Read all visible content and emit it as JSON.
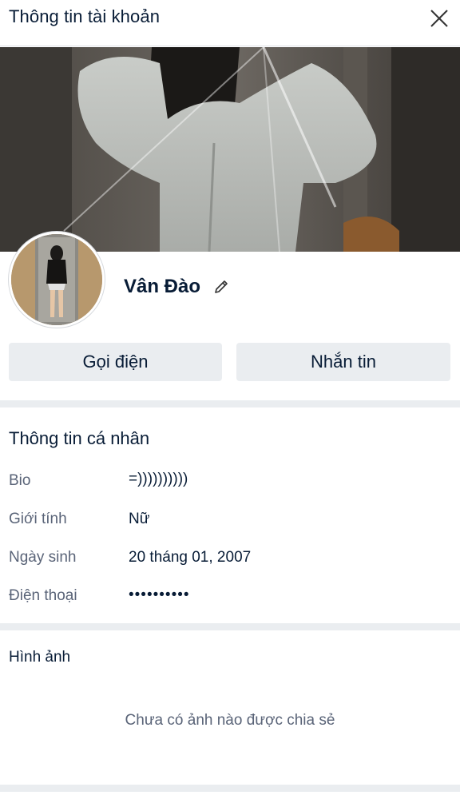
{
  "header": {
    "title": "Thông tin tài khoản",
    "close_icon": "close-icon"
  },
  "profile": {
    "name": "Vân Đào",
    "edit_icon": "pencil-icon"
  },
  "actions": {
    "call_label": "Gọi điện",
    "message_label": "Nhắn tin"
  },
  "personal_info": {
    "title": "Thông tin cá nhân",
    "rows": [
      {
        "label": "Bio",
        "value": "=))))))))))"
      },
      {
        "label": "Giới tính",
        "value": "Nữ"
      },
      {
        "label": "Ngày sinh",
        "value": "20 tháng 01, 2007"
      },
      {
        "label": "Điện thoại",
        "value": "••••••••••"
      }
    ]
  },
  "photos": {
    "title": "Hình ảnh",
    "empty_text": "Chưa có ảnh nào được chia sẻ"
  },
  "colors": {
    "text": "#081c36",
    "muted": "#5a6478",
    "button_bg": "#eaedf0",
    "separator": "#eaedf0"
  }
}
